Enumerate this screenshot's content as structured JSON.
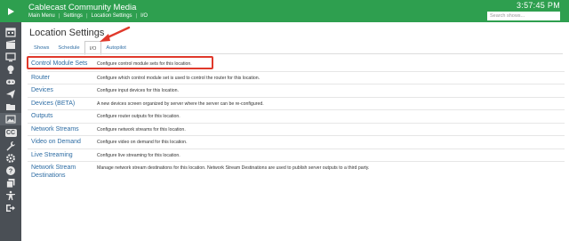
{
  "header": {
    "app_title": "Cablecast Community Media",
    "breadcrumb": [
      "Main Menu",
      "Settings",
      "Location Settings",
      "I/O"
    ],
    "clock": "3:57:45 PM",
    "search_placeholder": "Search shows...",
    "accent": "#2e9f4f"
  },
  "page": {
    "title": "Location Settings",
    "tabs": [
      {
        "label": "Shows",
        "active": false
      },
      {
        "label": "Schedule",
        "active": false
      },
      {
        "label": "I/O",
        "active": true
      },
      {
        "label": "Autopilot",
        "active": false
      }
    ]
  },
  "rail_icons": [
    "play-logo-icon",
    "calendar-icon",
    "clapperboard-icon",
    "monitor-icon",
    "lightbulb-icon",
    "gamepad-icon",
    "send-icon",
    "folder-icon",
    "image-icon",
    "cc-icon",
    "wrench-icon",
    "gear-icon",
    "question-icon",
    "copy-icon",
    "accessibility-icon",
    "logout-icon"
  ],
  "annotation": {
    "color": "#e0392b"
  },
  "settings": [
    {
      "name": "Control Module Sets",
      "desc": "Configure control module sets for this location."
    },
    {
      "name": "Router",
      "desc": "Configure which control module set is used to control the router for this location."
    },
    {
      "name": "Devices",
      "desc": "Configure input devices for this location."
    },
    {
      "name": "Devices (BETA)",
      "desc": "A new devices screen organized by server where the server can be re-configured."
    },
    {
      "name": "Outputs",
      "desc": "Configure router outputs for this location."
    },
    {
      "name": "Network Streams",
      "desc": "Configure network streams for this location."
    },
    {
      "name": "Video on Demand",
      "desc": "Configure video on demand for this location."
    },
    {
      "name": "Live Streaming",
      "desc": "Configure live streaming for this location."
    },
    {
      "name": "Network Stream Destinations",
      "desc": "Manage network stream destinations for this location. Network Stream Destinations are used to publish server outputs to a third party."
    }
  ]
}
